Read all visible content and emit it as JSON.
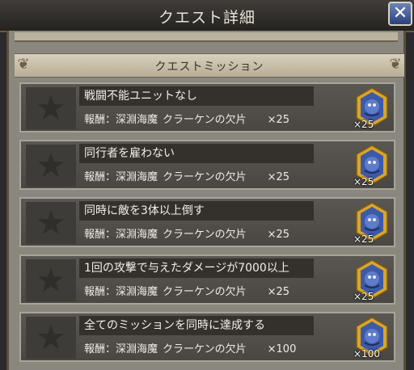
{
  "window": {
    "title": "クエスト詳細",
    "close_label": "✕"
  },
  "section": {
    "title": "クエストミッション"
  },
  "missions": [
    {
      "title": "戦闘不能ユニットなし",
      "reward_label": "報酬：深淵海魔",
      "reward_item": "クラーケンの欠片",
      "reward_qty": "×25",
      "icon_count": "×25"
    },
    {
      "title": "同行者を雇わない",
      "reward_label": "報酬：深淵海魔",
      "reward_item": "クラーケンの欠片",
      "reward_qty": "×25",
      "icon_count": "×25"
    },
    {
      "title": "同時に敵を3体以上倒す",
      "reward_label": "報酬：深淵海魔",
      "reward_item": "クラーケンの欠片",
      "reward_qty": "×25",
      "icon_count": "×25"
    },
    {
      "title": "1回の攻撃で与えたダメージが7000以上",
      "reward_label": "報酬：深淵海魔",
      "reward_item": "クラーケンの欠片",
      "reward_qty": "×25",
      "icon_count": "×25"
    },
    {
      "title": "全てのミッションを同時に達成する",
      "reward_label": "報酬：深淵海魔",
      "reward_item": "クラーケンの欠片",
      "reward_qty": "×100",
      "icon_count": "×100"
    }
  ],
  "colors": {
    "accent_gold": "#d9a52a",
    "item_blue": "#3d5aa8"
  },
  "icons": {
    "mission_status": "star-icon",
    "reward_item": "kraken-fragment-icon"
  }
}
